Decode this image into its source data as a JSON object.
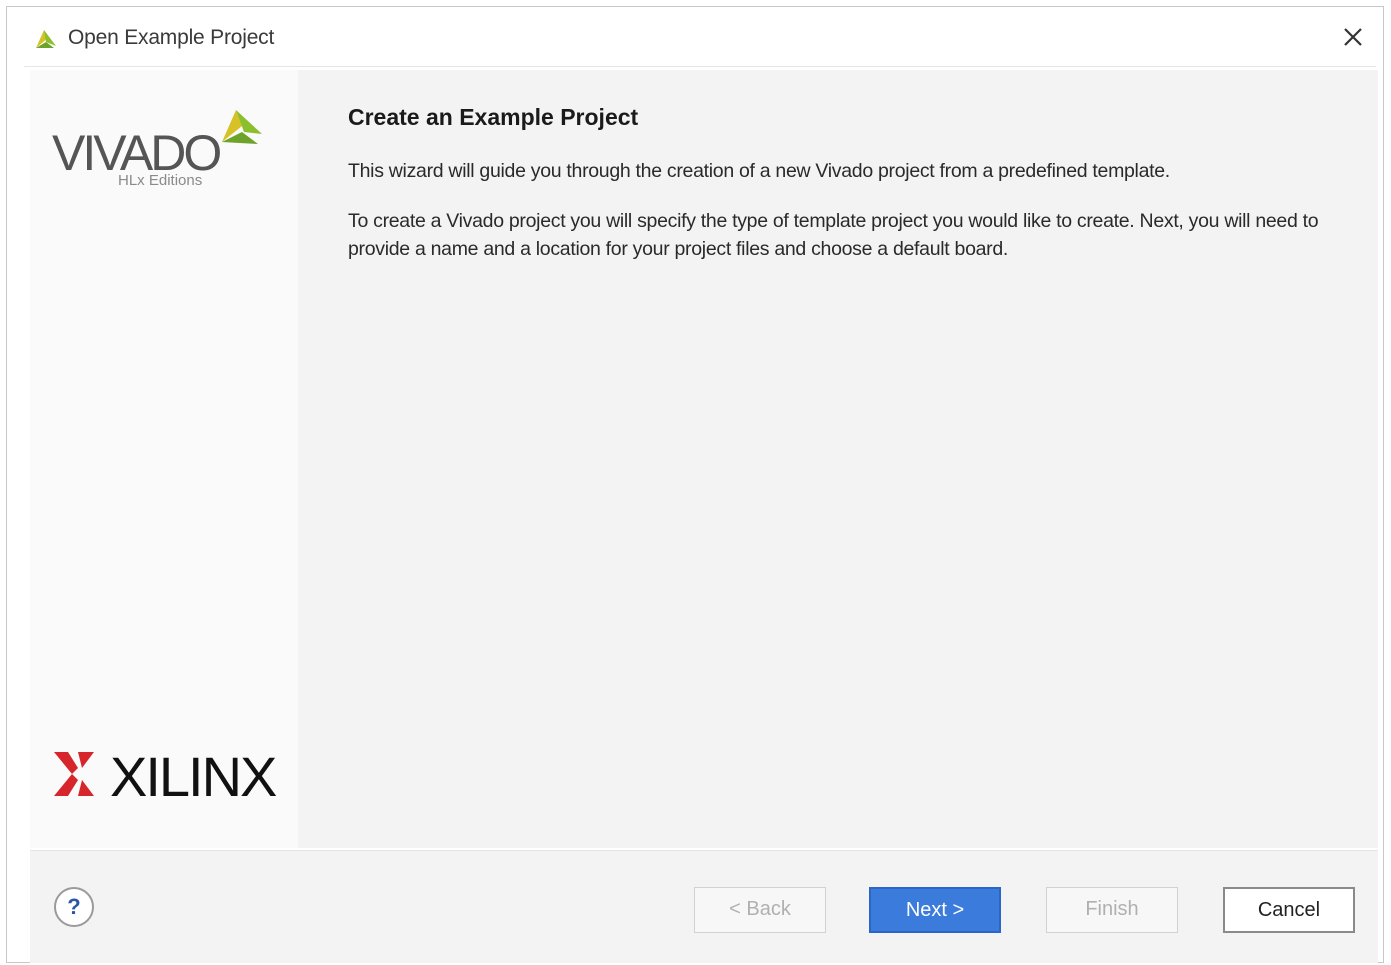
{
  "window": {
    "title": "Open Example Project",
    "icon": "vivado-leaf-icon",
    "close_icon": "close-icon"
  },
  "sidebar": {
    "vivado_logo_text": "VIVADO",
    "vivado_logo_sub": "HLx Editions",
    "xilinx_logo_text": "XILINX"
  },
  "main": {
    "heading": "Create an Example Project",
    "paragraph1": "This wizard will guide you through the creation of a new Vivado project from a predefined template.",
    "paragraph2": "To create a Vivado project you will specify the type of template project you would like to create. Next, you will need to provide a name and a location for your project files and choose a default board."
  },
  "footer": {
    "help_label": "?",
    "back_label": "< Back",
    "next_label": "Next >",
    "finish_label": "Finish",
    "cancel_label": "Cancel"
  },
  "colors": {
    "accent": "#3b7bdc",
    "leaf_green": "#8cbf2e",
    "leaf_yellow": "#d6c227",
    "xilinx_red": "#d7262b"
  }
}
